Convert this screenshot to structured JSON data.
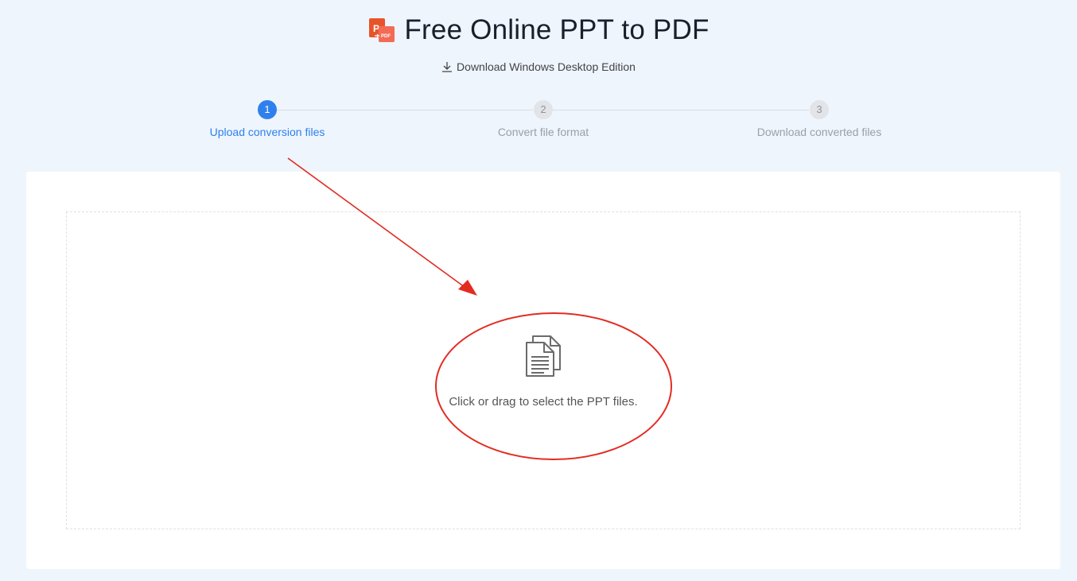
{
  "header": {
    "title": "Free Online PPT to PDF",
    "download_label": "Download Windows Desktop Edition"
  },
  "steps": [
    {
      "number": "1",
      "label": "Upload conversion files",
      "active": true
    },
    {
      "number": "2",
      "label": "Convert file format",
      "active": false
    },
    {
      "number": "3",
      "label": "Download converted files",
      "active": false
    }
  ],
  "dropzone": {
    "prompt": "Click or drag to select the PPT files."
  },
  "logo": {
    "text": "P",
    "badge": "PDF"
  },
  "colors": {
    "accent": "#2f80ed",
    "background": "#eef5fd",
    "annotation": "#e32b22",
    "logo_orange": "#e8542a"
  },
  "icons": {
    "download": "download-icon",
    "file": "document-files-icon"
  }
}
